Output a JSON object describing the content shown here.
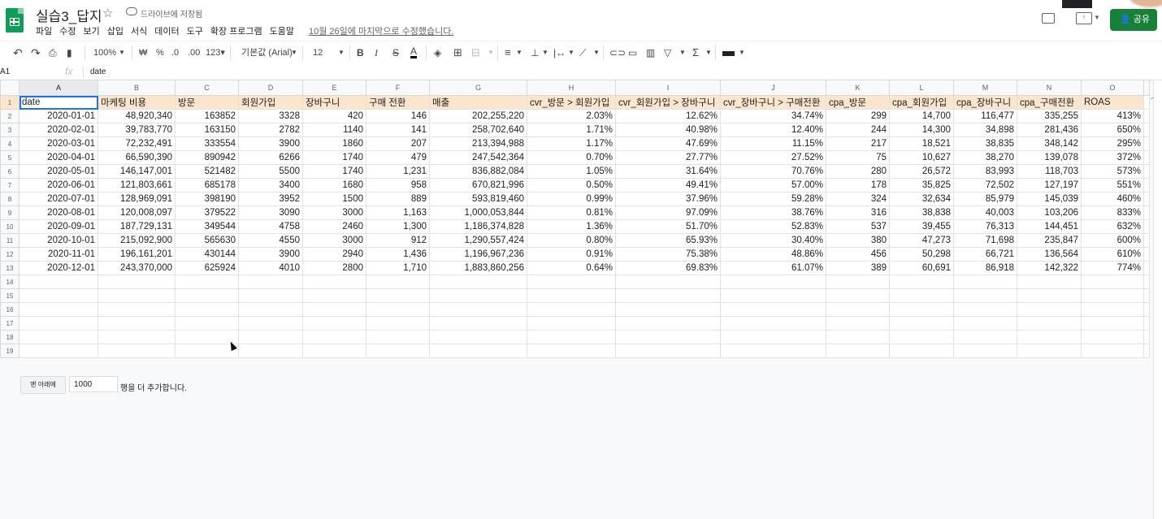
{
  "app": {
    "title": "실습3_답지",
    "saved_status": "드라이브에 저장됨",
    "last_edit": "10월 26일에 마지막으로 수정했습니다.",
    "share_label": "공유",
    "colors": {
      "brand": "#0f9d58",
      "share": "#188038",
      "header_fill": "#fce5cd",
      "selection": "#1a73e8"
    }
  },
  "menu": [
    "파일",
    "수정",
    "보기",
    "삽입",
    "서식",
    "데이터",
    "도구",
    "확장 프로그램",
    "도움말"
  ],
  "toolbar": {
    "zoom": "100%",
    "currency": "₩",
    "percent": "%",
    "dec_decrease": ".0",
    "dec_increase": ".00",
    "format_more": "123▾",
    "font": "기본값 (Arial)",
    "font_size": "12",
    "bold": "B",
    "italic": "I",
    "strike": "S",
    "textcolor": "A",
    "sum": "Σ"
  },
  "formula_bar": {
    "cell_ref": "A1",
    "fx": "fx",
    "value": "date"
  },
  "columns": [
    "A",
    "B",
    "C",
    "D",
    "E",
    "F",
    "G",
    "H",
    "I",
    "J",
    "K",
    "L",
    "M",
    "N",
    "O"
  ],
  "headers": [
    "date",
    "마케팅 비용",
    "방문",
    "회원가입",
    "장바구니",
    "구매 전환",
    "매출",
    "cvr_방문 > 회원가입",
    "cvr_회원가입 > 장바구니",
    "cvr_장바구니 > 구매전환",
    "cpa_방문",
    "cpa_회원가입",
    "cpa_장바구니",
    "cpa_구매전환",
    "ROAS"
  ],
  "rows": [
    [
      "2020-01-01",
      "48,920,340",
      "163852",
      "3328",
      "420",
      "146",
      "202,255,220",
      "2.03%",
      "12.62%",
      "34.74%",
      "299",
      "14,700",
      "116,477",
      "335,255",
      "413%"
    ],
    [
      "2020-02-01",
      "39,783,770",
      "163150",
      "2782",
      "1140",
      "141",
      "258,702,640",
      "1.71%",
      "40.98%",
      "12.40%",
      "244",
      "14,300",
      "34,898",
      "281,436",
      "650%"
    ],
    [
      "2020-03-01",
      "72,232,491",
      "333554",
      "3900",
      "1860",
      "207",
      "213,394,988",
      "1.17%",
      "47.69%",
      "11.15%",
      "217",
      "18,521",
      "38,835",
      "348,142",
      "295%"
    ],
    [
      "2020-04-01",
      "66,590,390",
      "890942",
      "6266",
      "1740",
      "479",
      "247,542,364",
      "0.70%",
      "27.77%",
      "27.52%",
      "75",
      "10,627",
      "38,270",
      "139,078",
      "372%"
    ],
    [
      "2020-05-01",
      "146,147,001",
      "521482",
      "5500",
      "1740",
      "1,231",
      "836,882,084",
      "1.05%",
      "31.64%",
      "70.76%",
      "280",
      "26,572",
      "83,993",
      "118,703",
      "573%"
    ],
    [
      "2020-06-01",
      "121,803,661",
      "685178",
      "3400",
      "1680",
      "958",
      "670,821,996",
      "0.50%",
      "49.41%",
      "57.00%",
      "178",
      "35,825",
      "72,502",
      "127,197",
      "551%"
    ],
    [
      "2020-07-01",
      "128,969,091",
      "398190",
      "3952",
      "1500",
      "889",
      "593,819,460",
      "0.99%",
      "37.96%",
      "59.28%",
      "324",
      "32,634",
      "85,979",
      "145,039",
      "460%"
    ],
    [
      "2020-08-01",
      "120,008,097",
      "379522",
      "3090",
      "3000",
      "1,163",
      "1,000,053,844",
      "0.81%",
      "97.09%",
      "38.76%",
      "316",
      "38,838",
      "40,003",
      "103,206",
      "833%"
    ],
    [
      "2020-09-01",
      "187,729,131",
      "349544",
      "4758",
      "2460",
      "1,300",
      "1,186,374,828",
      "1.36%",
      "51.70%",
      "52.83%",
      "537",
      "39,455",
      "76,313",
      "144,451",
      "632%"
    ],
    [
      "2020-10-01",
      "215,092,900",
      "565630",
      "4550",
      "3000",
      "912",
      "1,290,557,424",
      "0.80%",
      "65.93%",
      "30.40%",
      "380",
      "47,273",
      "71,698",
      "235,847",
      "600%"
    ],
    [
      "2020-11-01",
      "196,161,201",
      "430144",
      "3900",
      "2940",
      "1,436",
      "1,196,967,236",
      "0.91%",
      "75.38%",
      "48.86%",
      "456",
      "50,298",
      "66,721",
      "136,564",
      "610%"
    ],
    [
      "2020-12-01",
      "243,370,000",
      "625924",
      "4010",
      "2800",
      "1,710",
      "1,883,860,256",
      "0.64%",
      "69.83%",
      "61.07%",
      "389",
      "60,691",
      "86,918",
      "142,322",
      "774%"
    ]
  ],
  "row_numbers": [
    "1",
    "2",
    "3",
    "4",
    "5",
    "6",
    "7",
    "8",
    "9",
    "10",
    "11",
    "12",
    "13",
    "14",
    "15",
    "16",
    "17",
    "18",
    "19"
  ],
  "add_rows": {
    "button_label": "맨 아래에",
    "count": "1000",
    "suffix": "행을 더 추가합니다."
  }
}
